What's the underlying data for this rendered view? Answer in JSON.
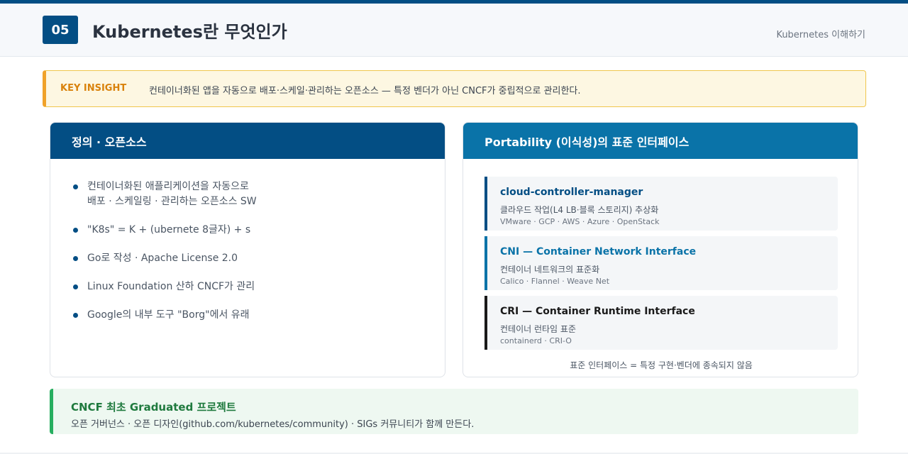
{
  "header": {
    "number": "05",
    "title": "Kubernetes란 무엇인가",
    "section": "Kubernetes 이해하기"
  },
  "insight": {
    "label": "KEY INSIGHT",
    "text": "컨테이너화된 앱을 자동으로 배포·스케일·관리하는 오픈소스 — 특정 벤더가 아닌 CNCF가 중립적으로 관리한다."
  },
  "definition": {
    "title": "정의 · 오픈소스",
    "items": [
      {
        "line1": "컨테이너화된 애플리케이션을 자동으로",
        "line2": "배포 · 스케일링 · 관리하는 오픈소스 SW"
      },
      {
        "line1": "\"K8s\" = K + (ubernete 8글자) + s",
        "line2": ""
      },
      {
        "line1": "Go로 작성 · Apache License 2.0",
        "line2": ""
      },
      {
        "line1": "Linux Foundation 산하 CNCF가 관리",
        "line2": ""
      },
      {
        "line1": "Google의 내부 도구 \"Borg\"에서 유래",
        "line2": ""
      }
    ]
  },
  "portability": {
    "title": "Portability (이식성)의 표준 인터페이스",
    "interfaces": [
      {
        "name": "cloud-controller-manager",
        "desc": "클라우드 작업(L4 LB·블록 스토리지) 추상화",
        "examples": "VMware · GCP · AWS · Azure · OpenStack",
        "color": "#034e84"
      },
      {
        "name": "CNI — Container Network Interface",
        "desc": "컨테이너 네트워크의 표준화",
        "examples": "Calico · Flannel · Weave Net",
        "color": "#0a73a8"
      },
      {
        "name": "CRI — Container Runtime Interface",
        "desc": "컨테이너 런타임 표준",
        "examples": "containerd · CRI-O",
        "color": "#1a1a1a"
      }
    ],
    "footnote": "표준 인터페이스 = 특정 구현·벤더에 종속되지 않음"
  },
  "cncf": {
    "title": "CNCF 최초 Graduated 프로젝트",
    "desc": "오픈 거버넌스 · 오픈 디자인(github.com/kubernetes/community) · SIGs 커뮤니티가 함께 만든다."
  }
}
